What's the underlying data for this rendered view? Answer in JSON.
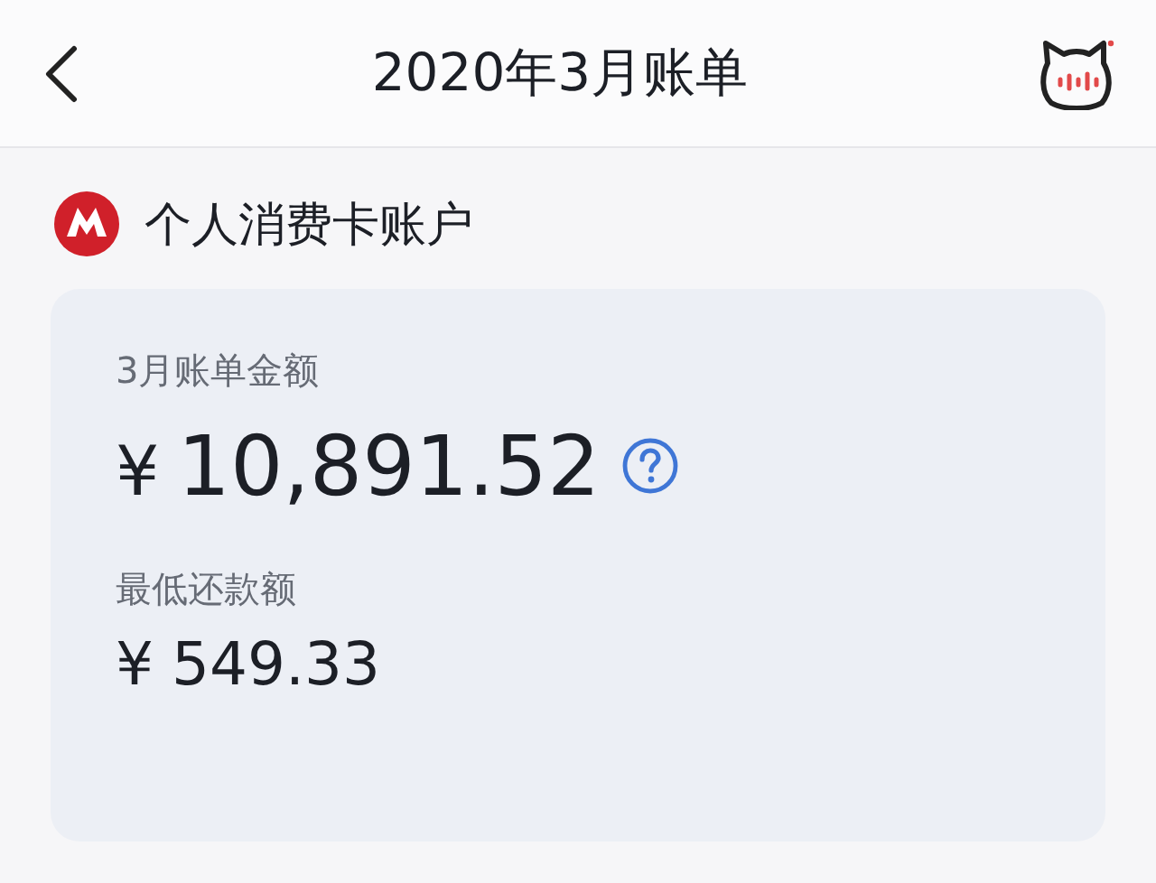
{
  "header": {
    "title": "2020年3月账单"
  },
  "account": {
    "name": "个人消费卡账户"
  },
  "bill": {
    "label": "3月账单金额",
    "currency": "¥",
    "amount": "10,891.52"
  },
  "minimum": {
    "label": "最低还款额",
    "currency": "¥",
    "amount": "549.33"
  }
}
